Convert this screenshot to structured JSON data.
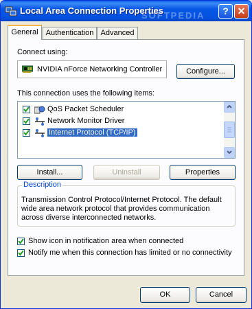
{
  "window": {
    "title": "Local Area Connection Properties",
    "watermark": "SOFTPEDIA",
    "help_glyph": "?",
    "close_glyph": "✕"
  },
  "tabs": [
    {
      "label": "General",
      "active": true
    },
    {
      "label": "Authentication",
      "active": false
    },
    {
      "label": "Advanced",
      "active": false
    }
  ],
  "general": {
    "connect_using_label": "Connect using:",
    "adapter_name": "NVIDIA nForce Networking Controller",
    "configure_button": "Configure...",
    "items_label": "This connection uses the following items:",
    "items": [
      {
        "label": "QoS Packet Scheduler",
        "checked": true,
        "icon": "qos-scheduler-icon"
      },
      {
        "label": "Network Monitor Driver",
        "checked": true,
        "icon": "network-protocol-icon"
      },
      {
        "label": "Internet Protocol (TCP/IP)",
        "checked": true,
        "icon": "network-protocol-icon",
        "selected": true
      }
    ],
    "install_button": "Install...",
    "uninstall_button": "Uninstall",
    "properties_button": "Properties",
    "description_label": "Description",
    "description_text": "Transmission Control Protocol/Internet Protocol. The default wide area network protocol that provides communication across diverse interconnected networks.",
    "show_icon_label": "Show icon in notification area when connected",
    "show_icon_checked": true,
    "notify_label": "Notify me when this connection has limited or no connectivity",
    "notify_checked": true
  },
  "footer": {
    "ok_button": "OK",
    "cancel_button": "Cancel"
  }
}
